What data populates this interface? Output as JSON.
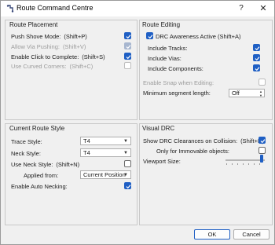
{
  "window": {
    "title": "Route Command Centre",
    "help_glyph": "?",
    "close_glyph": "✕"
  },
  "colors": {
    "accent": "#1f5fc4",
    "panel_bg": "#f0f0f0",
    "disabled_text": "#9c9c9c"
  },
  "route_placement": {
    "title": "Route Placement",
    "items": [
      {
        "label": "Push Shove Mode:",
        "shortcut": "(Shift+P)",
        "checked": true,
        "enabled": true
      },
      {
        "label": "Allow Via Pushing:",
        "shortcut": "(Shift+V)",
        "checked": true,
        "enabled": false
      },
      {
        "label": "Enable Click to Complete:",
        "shortcut": "(Shift+S)",
        "checked": true,
        "enabled": true
      },
      {
        "label": "Use Curved Corners:",
        "shortcut": "(Shift+C)",
        "checked": false,
        "enabled": false
      }
    ]
  },
  "route_editing": {
    "title": "Route Editing",
    "drc_awareness": {
      "label": "DRC Awareness Active (Shift+A)",
      "checked": true
    },
    "includes": [
      {
        "label": "Include Tracks:",
        "checked": true
      },
      {
        "label": "Include Vias:",
        "checked": true
      },
      {
        "label": "Include Components:",
        "checked": true
      }
    ],
    "snap": {
      "label": "Enable Snap when Editing:",
      "checked": false,
      "enabled": false
    },
    "min_segment": {
      "label": "Minimum segment length:",
      "value": "Off"
    }
  },
  "current_route_style": {
    "title": "Current Route Style",
    "trace_style": {
      "label": "Trace Style:",
      "value": "T4"
    },
    "neck_style": {
      "label": "Neck Style:",
      "value": "T4"
    },
    "use_neck_style": {
      "label": "Use Neck Style:",
      "shortcut": "(Shift+N)",
      "checked": false
    },
    "applied_from": {
      "label": "Applied from:",
      "value": "Current Position"
    },
    "auto_necking": {
      "label": "Enable Auto Necking:",
      "checked": true
    }
  },
  "visual_drc": {
    "title": "Visual DRC",
    "show_clearances": {
      "label": "Show DRC Clearances on Collision:",
      "shortcut": "(Shift+D)",
      "checked": true
    },
    "immovable_only": {
      "label": "Only for Immovable objects:",
      "checked": false
    },
    "viewport_size": {
      "label": "Viewport Size:",
      "level": 1.0
    }
  },
  "buttons": {
    "ok": "OK",
    "cancel": "Cancel"
  }
}
